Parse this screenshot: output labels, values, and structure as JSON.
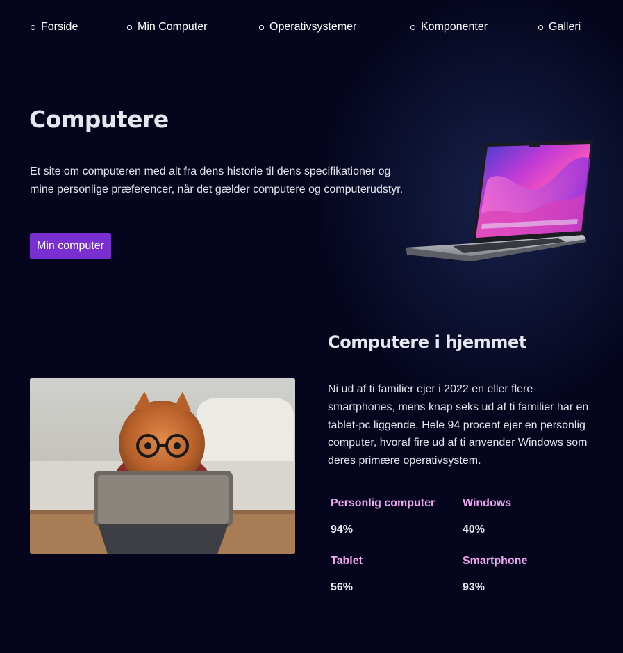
{
  "nav": {
    "items": [
      {
        "label": "Forside"
      },
      {
        "label": "Min Computer"
      },
      {
        "label": "Operativsystemer"
      },
      {
        "label": "Komponenter"
      },
      {
        "label": "Galleri"
      }
    ]
  },
  "hero": {
    "title": "Computere",
    "text": "Et site om computeren med alt fra dens historie til dens specifikationer og mine personlige præferencer, når det gælder computere og computerudstyr.",
    "button_label": "Min computer",
    "image_icon": "laptop-image"
  },
  "home": {
    "title": "Computere i hjemmet",
    "text": "Ni ud af ti familier ejer i 2022 en eller flere smartphones, mens knap seks ud af ti familier har en tablet-pc liggende. Hele 94 procent ejer en personlig computer, hvoraf fire ud af ti anvender Windows som deres primære operativsystem.",
    "image_icon": "dog-with-tablet-image",
    "stats": [
      {
        "label": "Personlig computer",
        "value": "94%"
      },
      {
        "label": "Windows",
        "value": "40%"
      },
      {
        "label": "Tablet",
        "value": "56%"
      },
      {
        "label": "Smartphone",
        "value": "93%"
      }
    ]
  },
  "colors": {
    "background": "#05061e",
    "accent_button": "#7a2fd0",
    "stat_label": "#f2a6f2",
    "text": "#e4e4ec"
  }
}
